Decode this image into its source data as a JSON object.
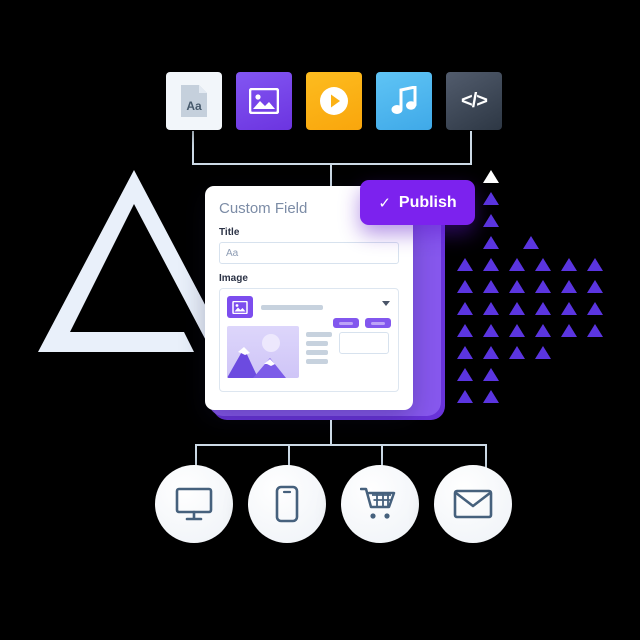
{
  "scene": {
    "title": "Custom Field CMS illustration",
    "background": "#000000",
    "connector_color": "#CCDAE6",
    "accent_purple": "#7C22EE",
    "logo": {
      "name": "delta-triangle-logo",
      "color": "#E8EFF9"
    }
  },
  "media_cards": [
    {
      "name": "document-card",
      "icon": "document-aa-icon",
      "label": "Aa",
      "color": "#F2F6FA"
    },
    {
      "name": "image-card",
      "icon": "picture-icon",
      "label": "",
      "color": "#7C4DE8"
    },
    {
      "name": "video-card",
      "icon": "play-circle-icon",
      "label": "",
      "color": "#FBB114"
    },
    {
      "name": "audio-card",
      "icon": "music-note-icon",
      "label": "",
      "color": "#4FB9F0"
    },
    {
      "name": "code-card",
      "icon": "code-icon",
      "label": "</>",
      "color": "#3A4452"
    }
  ],
  "panel": {
    "title": "Custom Field",
    "fields": [
      {
        "label": "Title",
        "value": "Aa",
        "placeholder": "Aa"
      },
      {
        "label": "Image",
        "value": "",
        "placeholder": ""
      }
    ],
    "image_widget": {
      "dropdown_caret": "caret-down-icon",
      "thumbnail_icon": "picture-icon",
      "buttons": [
        "edit-button",
        "remove-button"
      ],
      "preview": "mountain-photo-placeholder"
    }
  },
  "publish_button": {
    "label": "Publish",
    "check": "✓",
    "color": "#7C22EE"
  },
  "channels": [
    {
      "name": "desktop-channel",
      "icon": "desktop-monitor-icon"
    },
    {
      "name": "mobile-channel",
      "icon": "mobile-phone-icon"
    },
    {
      "name": "ecommerce-channel",
      "icon": "shopping-cart-icon"
    },
    {
      "name": "email-channel",
      "icon": "envelope-icon"
    }
  ],
  "decoration": {
    "triangle_field": {
      "name": "triangle-dot-pattern",
      "color": "#5B35E0",
      "highlight": "#FFFFFF"
    }
  }
}
